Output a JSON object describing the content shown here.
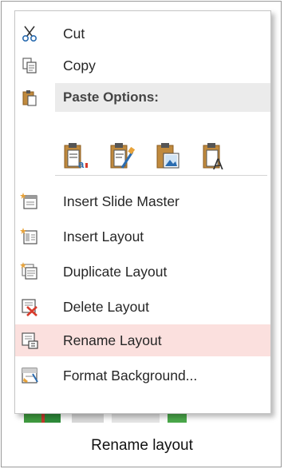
{
  "menu": {
    "cut": {
      "label": "Cut",
      "icon": "scissors-icon"
    },
    "copy": {
      "label": "Copy",
      "icon": "copy-icon"
    },
    "paste_options": {
      "label": "Paste Options:",
      "icon": "clipboard-icon"
    },
    "paste_buttons": [
      {
        "icon": "paste-use-destination-theme-icon"
      },
      {
        "icon": "paste-keep-source-formatting-icon"
      },
      {
        "icon": "paste-picture-icon"
      },
      {
        "icon": "paste-keep-text-only-icon"
      }
    ],
    "insert_slide_master": {
      "label": "Insert Slide Master",
      "icon": "insert-slide-master-icon"
    },
    "insert_layout": {
      "label": "Insert Layout",
      "icon": "insert-layout-icon"
    },
    "duplicate_layout": {
      "label": "Duplicate Layout",
      "icon": "duplicate-layout-icon"
    },
    "delete_layout": {
      "label": "Delete Layout",
      "icon": "delete-layout-icon"
    },
    "rename_layout": {
      "label": "Rename Layout",
      "icon": "rename-layout-icon",
      "highlighted": true
    },
    "format_background": {
      "label": "Format Background...",
      "icon": "format-background-icon"
    }
  },
  "caption": "Rename layout",
  "colors": {
    "highlight": "#fbe0de",
    "section_band": "#ebebeb",
    "delete_red": "#d83b2b",
    "accent_blue": "#2b6cb0",
    "accent_orange": "#e8a33a"
  }
}
